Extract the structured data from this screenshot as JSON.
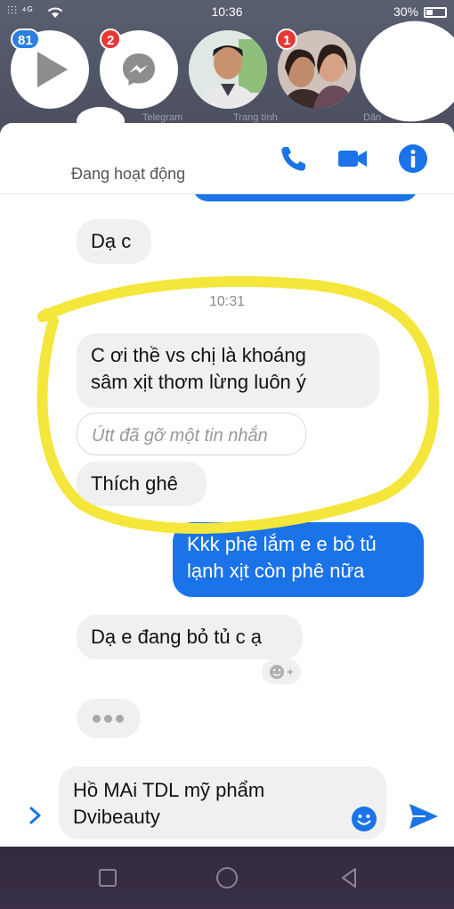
{
  "status_bar": {
    "signal": "⫶⫶⫶ ⁴ᴳ",
    "time": "10:36",
    "battery": "30%"
  },
  "chat_heads": [
    {
      "badge": "81",
      "label": "",
      "icon": "play-icon"
    },
    {
      "badge": "2",
      "label": "Telegram",
      "icon": "messenger-icon"
    },
    {
      "badge": "",
      "label": "Trang tính",
      "icon": "avatar-man"
    },
    {
      "badge": "1",
      "label": "Dân",
      "icon": "avatar-women"
    }
  ],
  "header": {
    "active_status": "Đang hoạt động"
  },
  "messages": {
    "m1": "Dạ c",
    "timestamp": "10:31",
    "m2_line1": "C ơi thề vs chị là khoáng",
    "m2_line2": "sâm xịt thơm lừng luôn ý",
    "removed": "Útt đã gỡ một tin nhắn",
    "m3": "Thích ghê",
    "m4_line1": "Kkk phê lắm e e bỏ tủ",
    "m4_line2": "lạnh xịt còn phê nữa",
    "m5": "Dạ e đang bỏ tủ c ạ"
  },
  "composer": {
    "line1": "Hồ MAi TDL mỹ phẩm",
    "line2": "Dvibeauty"
  },
  "colors": {
    "messenger_blue": "#1a73e8",
    "incoming_bubble": "#f1f0f0",
    "highlight": "#f4e63a"
  }
}
